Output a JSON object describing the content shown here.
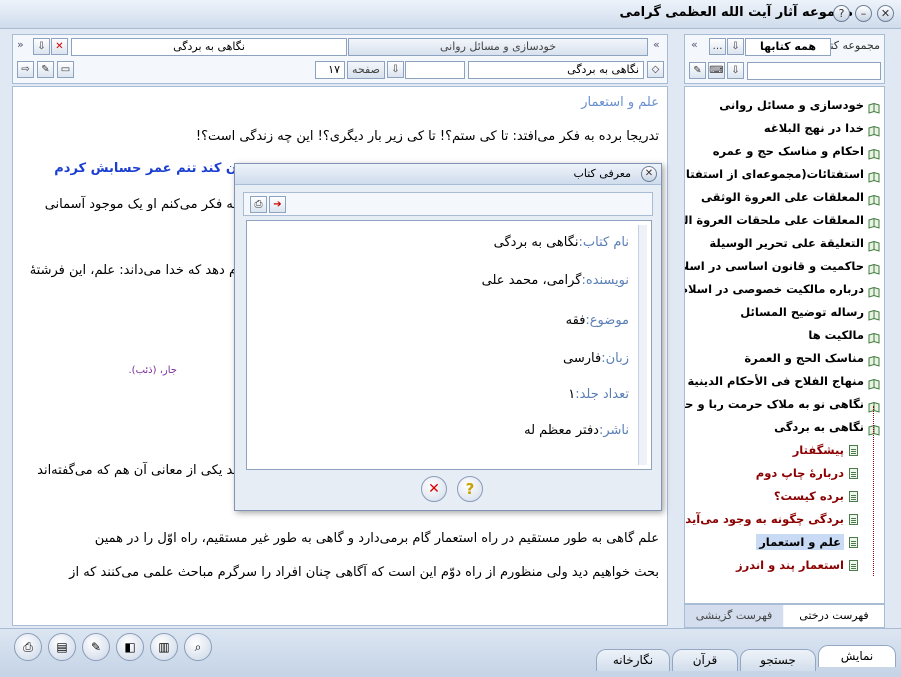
{
  "titlebar": {
    "title": "مجموعه آثار آیت الله العظمی گرامی"
  },
  "left_panel": {
    "tab_inactive": "خودسازی و مسائل روانی",
    "tab_active": "نگاهی به بردگی",
    "book_field": "نگاهی به بردگی",
    "page_label": "صفحه",
    "page_value": "۱۷"
  },
  "right_panel": {
    "header_label": "مجموعه کتب",
    "combo_value": "همه کتابها",
    "tab_tree": "فهرست درختی",
    "tab_index": "فهرست گزینشی"
  },
  "reader": {
    "lines": [
      {
        "text": "علم و استعمار",
        "color": "#6a8fd0"
      },
      {
        "text": "تدریجا برده به فکر می‌افتد: تا کی ستم؟! تا کی زیر بار دیگری؟! این چه زندگی است؟!",
        "color": "#000"
      },
      {
        "text": "ن کند تنم عمر حسابش کردم",
        "color": "#1a3fd0"
      },
      {
        "text": "به فکر می‌کنم او یک موجود آسمانی",
        "color": "#000"
      },
      {
        "text": "م دهد که خدا می‌داند: علم، این فرشتهٔ",
        "color": "#000"
      },
      {
        "text": "جار، (ذئب).",
        "color": "#7a2a9a"
      },
      {
        "text": "ید یکی از معانی آن هم که می‌گفته‌اند",
        "color": "#000"
      },
      {
        "text": "علم گاهی به طور مستقیم در راه استعمار گام برمی‌دارد و گاهی به طور غیر مستقیم، راه اوّل را در همین",
        "color": "#000"
      },
      {
        "text": "بحث خواهیم دید ولی منظورم از راه دوّم این است که آگاهی چنان افراد را سرگرم مباحث علمی می‌کنند که از",
        "color": "#000"
      }
    ]
  },
  "tree": {
    "items": [
      {
        "label": "خودسازی و مسائل روانی",
        "type": "book"
      },
      {
        "label": "خدا در نهج البلاغه",
        "type": "book"
      },
      {
        "label": "احکام و مناسک حج و عمره",
        "type": "book"
      },
      {
        "label": "استفتائات(مجموعه‌ای از استفتائات)",
        "type": "book"
      },
      {
        "label": "المعلقات علی العروة الوثقی",
        "type": "book"
      },
      {
        "label": "المعلقات علی ملحقات العروة الوثقی",
        "type": "book"
      },
      {
        "label": "التعلیقة علی تحریر الوسیلة",
        "type": "book"
      },
      {
        "label": "حاکمیت و قانون اساسی در اسلام",
        "type": "book"
      },
      {
        "label": "درباره مالکیت خصوصی در اسلام",
        "type": "book"
      },
      {
        "label": "رساله توضیح المسائل",
        "type": "book"
      },
      {
        "label": "مالکیت ها",
        "type": "book"
      },
      {
        "label": "مناسک الحج و العمرة",
        "type": "book"
      },
      {
        "label": "منهاج الفلاح فی الأحکام الدینیة",
        "type": "book"
      },
      {
        "label": "نگاهی نو به ملاک حرمت ربا و حیل",
        "type": "book"
      },
      {
        "label": "نگاهی به بردگی",
        "type": "open"
      },
      {
        "label": "پیشگفتار",
        "type": "sub"
      },
      {
        "label": "دربارۀ چاپ دوم",
        "type": "sub"
      },
      {
        "label": "برده کیست؟",
        "type": "sub"
      },
      {
        "label": "بردگی چگونه به وجود می‌آید؟",
        "type": "sub"
      },
      {
        "label": "علم و استعمار",
        "type": "selected"
      },
      {
        "label": "استعمار پند و اندرز",
        "type": "sub"
      }
    ]
  },
  "dialog": {
    "title": "معرفی کتاب",
    "rows": [
      {
        "key": "نام کتاب:",
        "value": "نگاهی به بردگی"
      },
      {
        "key": "نویسنده:",
        "value": "گرامی، محمد علی"
      },
      {
        "key": "موضوع:",
        "value": "فقه"
      },
      {
        "key": "زبان:",
        "value": "فارسی"
      },
      {
        "key": "تعداد جلد:",
        "value": "۱"
      },
      {
        "key": "ناشر:",
        "value": "دفتر معظم له"
      }
    ]
  },
  "bottom_tabs": [
    "نمایش",
    "جستجو",
    "قرآن",
    "نگارخانه"
  ],
  "colors": {
    "accent": "#5a7fb5",
    "highlight_blue": "#1a3fd0",
    "subitem": "#8b0000",
    "selected_bg": "#c9daf5"
  }
}
